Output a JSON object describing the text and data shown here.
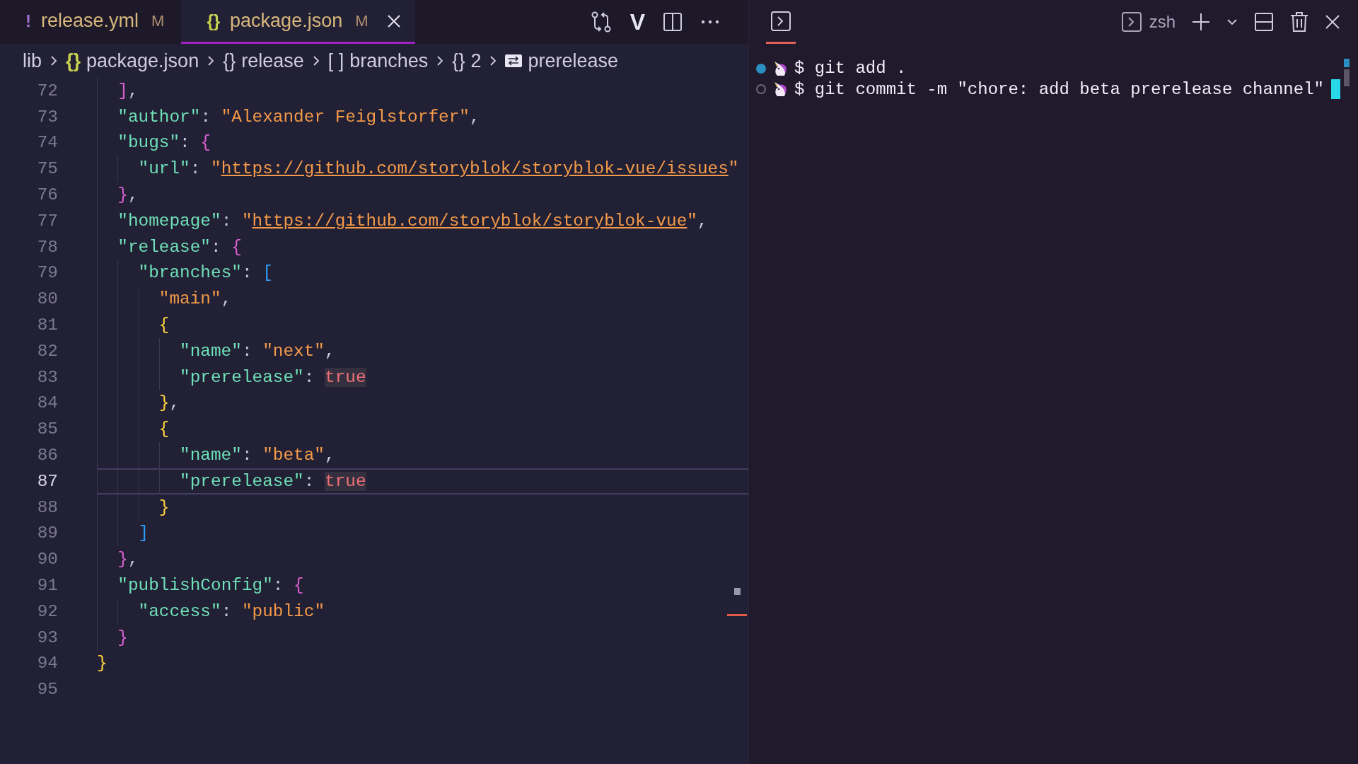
{
  "editor": {
    "tabs": [
      {
        "kind": "yaml",
        "icon": "!",
        "label": "release.yml",
        "badge": "M",
        "selected": false
      },
      {
        "kind": "json",
        "icon": "{}",
        "label": "package.json",
        "badge": "M",
        "selected": true
      }
    ],
    "toolbar": [
      {
        "kind": "compare"
      },
      {
        "kind": "letter",
        "label": "V"
      },
      {
        "kind": "split"
      },
      {
        "kind": "more"
      }
    ],
    "breadcrumbs": [
      {
        "kind": "folder",
        "label": "lib"
      },
      {
        "kind": "file",
        "icon": "{}",
        "label": "package.json"
      },
      {
        "kind": "object",
        "icon": "{}",
        "label": "release"
      },
      {
        "kind": "array",
        "icon": "[ ]",
        "label": "branches"
      },
      {
        "kind": "object",
        "icon": "{}",
        "label": "2"
      },
      {
        "kind": "property",
        "label": "prerelease"
      }
    ],
    "lines": [
      {
        "number": "72",
        "current": false,
        "tokens": [
          {
            "kind": "bracket2",
            "text": "  ]"
          },
          {
            "kind": "punct",
            "text": ","
          }
        ]
      },
      {
        "number": "73",
        "current": false,
        "tokens": [
          {
            "kind": "key",
            "text": "  \"author\""
          },
          {
            "kind": "punct",
            "text": ": "
          },
          {
            "kind": "string",
            "text": "\"Alexander Feiglstorfer\""
          },
          {
            "kind": "punct",
            "text": ","
          }
        ]
      },
      {
        "number": "74",
        "current": false,
        "tokens": [
          {
            "kind": "key",
            "text": "  \"bugs\""
          },
          {
            "kind": "punct",
            "text": ": "
          },
          {
            "kind": "bracket2",
            "text": "{"
          }
        ]
      },
      {
        "number": "75",
        "current": false,
        "tokens": [
          {
            "kind": "key",
            "text": "    \"url\""
          },
          {
            "kind": "punct",
            "text": ": "
          },
          {
            "kind": "string",
            "text": "\""
          },
          {
            "kind": "url",
            "text": "https://github.com/storyblok/storyblok-vue/issues"
          },
          {
            "kind": "string",
            "text": "\""
          }
        ]
      },
      {
        "number": "76",
        "current": false,
        "tokens": [
          {
            "kind": "bracket2",
            "text": "  }"
          },
          {
            "kind": "punct",
            "text": ","
          }
        ]
      },
      {
        "number": "77",
        "current": false,
        "tokens": [
          {
            "kind": "key",
            "text": "  \"homepage\""
          },
          {
            "kind": "punct",
            "text": ": "
          },
          {
            "kind": "string",
            "text": "\""
          },
          {
            "kind": "url",
            "text": "https://github.com/storyblok/storyblok-vue"
          },
          {
            "kind": "string",
            "text": "\""
          },
          {
            "kind": "punct",
            "text": ","
          }
        ]
      },
      {
        "number": "78",
        "current": false,
        "tokens": [
          {
            "kind": "key",
            "text": "  \"release\""
          },
          {
            "kind": "punct",
            "text": ": "
          },
          {
            "kind": "bracket2",
            "text": "{"
          }
        ]
      },
      {
        "number": "79",
        "current": false,
        "tokens": [
          {
            "kind": "key",
            "text": "    \"branches\""
          },
          {
            "kind": "punct",
            "text": ": "
          },
          {
            "kind": "bracket3",
            "text": "["
          }
        ]
      },
      {
        "number": "80",
        "current": false,
        "tokens": [
          {
            "kind": "string",
            "text": "      \"main\""
          },
          {
            "kind": "punct",
            "text": ","
          }
        ]
      },
      {
        "number": "81",
        "current": false,
        "tokens": [
          {
            "kind": "bracket1",
            "text": "      {"
          }
        ]
      },
      {
        "number": "82",
        "current": false,
        "tokens": [
          {
            "kind": "key",
            "text": "        \"name\""
          },
          {
            "kind": "punct",
            "text": ": "
          },
          {
            "kind": "string",
            "text": "\"next\""
          },
          {
            "kind": "punct",
            "text": ","
          }
        ]
      },
      {
        "number": "83",
        "current": false,
        "tokens": [
          {
            "kind": "key",
            "text": "        \"prerelease\""
          },
          {
            "kind": "punct",
            "text": ": "
          },
          {
            "kind": "bool",
            "text": "true"
          }
        ]
      },
      {
        "number": "84",
        "current": false,
        "tokens": [
          {
            "kind": "bracket1",
            "text": "      }"
          },
          {
            "kind": "punct",
            "text": ","
          }
        ]
      },
      {
        "number": "85",
        "current": false,
        "tokens": [
          {
            "kind": "bracket1",
            "text": "      {"
          }
        ]
      },
      {
        "number": "86",
        "current": false,
        "tokens": [
          {
            "kind": "key",
            "text": "        \"name\""
          },
          {
            "kind": "punct",
            "text": ": "
          },
          {
            "kind": "string",
            "text": "\"beta\""
          },
          {
            "kind": "punct",
            "text": ","
          }
        ]
      },
      {
        "number": "87",
        "current": true,
        "tokens": [
          {
            "kind": "key",
            "text": "        \"prerelease\""
          },
          {
            "kind": "punct",
            "text": ": "
          },
          {
            "kind": "bool",
            "text": "true"
          }
        ]
      },
      {
        "number": "88",
        "current": false,
        "tokens": [
          {
            "kind": "bracket1",
            "text": "      }"
          }
        ]
      },
      {
        "number": "89",
        "current": false,
        "tokens": [
          {
            "kind": "bracket3",
            "text": "    ]"
          }
        ]
      },
      {
        "number": "90",
        "current": false,
        "tokens": [
          {
            "kind": "bracket2",
            "text": "  }"
          },
          {
            "kind": "punct",
            "text": ","
          }
        ]
      },
      {
        "number": "91",
        "current": false,
        "tokens": [
          {
            "kind": "key",
            "text": "  \"publishConfig\""
          },
          {
            "kind": "punct",
            "text": ": "
          },
          {
            "kind": "bracket2",
            "text": "{"
          }
        ]
      },
      {
        "number": "92",
        "current": false,
        "tokens": [
          {
            "kind": "key",
            "text": "    \"access\""
          },
          {
            "kind": "punct",
            "text": ": "
          },
          {
            "kind": "string",
            "text": "\"public\""
          }
        ]
      },
      {
        "number": "93",
        "current": false,
        "tokens": [
          {
            "kind": "bracket2",
            "text": "  }"
          }
        ]
      },
      {
        "number": "94",
        "current": false,
        "tokens": [
          {
            "kind": "bracket1",
            "text": "}"
          }
        ]
      },
      {
        "number": "95",
        "current": false
      }
    ]
  },
  "terminal": {
    "panel_tabs": [
      {
        "kind": "terminal",
        "selected": true
      }
    ],
    "shell": "zsh",
    "actions": [
      {
        "kind": "add"
      },
      {
        "kind": "chevron"
      },
      {
        "kind": "split"
      },
      {
        "kind": "trash"
      },
      {
        "kind": "close"
      }
    ],
    "lines": [
      {
        "done": true,
        "prompt": "$",
        "command": "git add .",
        "cursor": false
      },
      {
        "done": false,
        "prompt": "$",
        "command": "git commit -m \"chore: add beta prerelease channel\"",
        "cursor": true
      }
    ]
  }
}
